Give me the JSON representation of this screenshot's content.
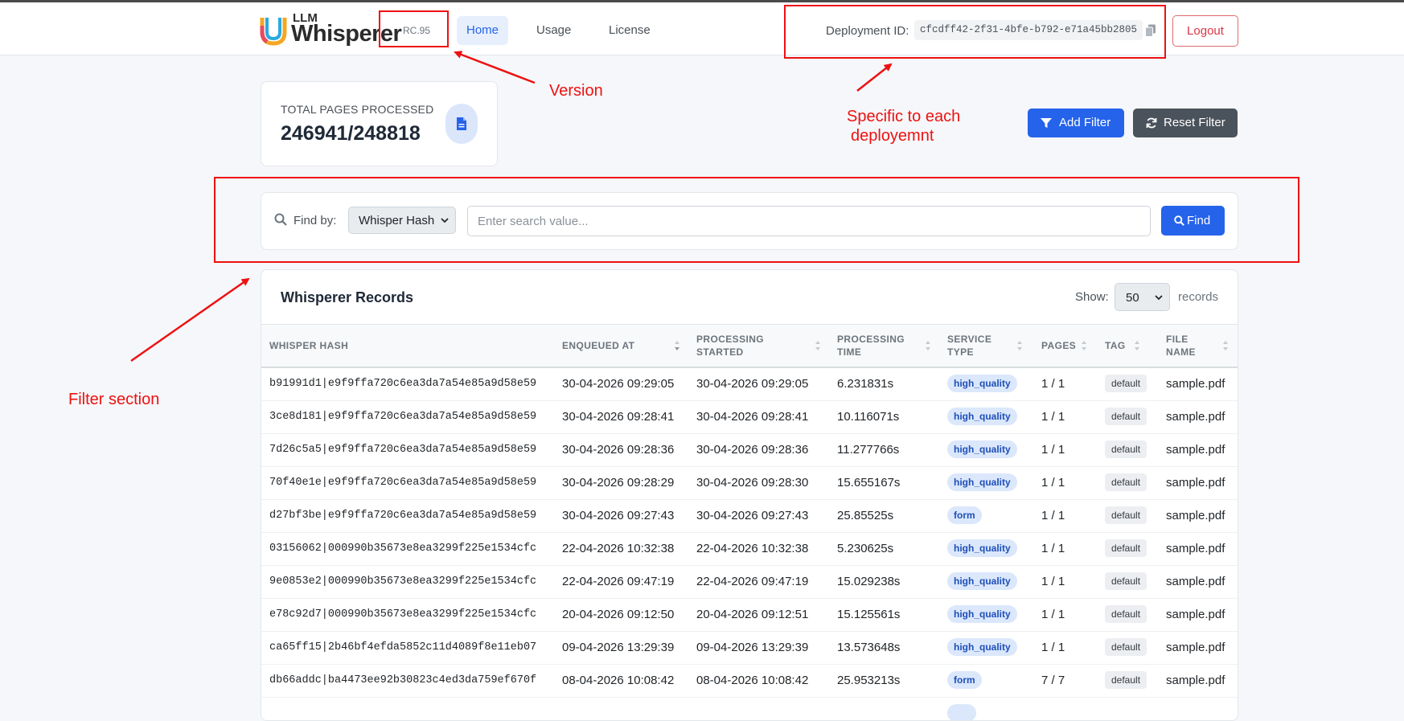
{
  "app": {
    "logo_top": "LLM",
    "logo_name": "Whisperer",
    "version": "RC.95"
  },
  "nav": {
    "home": "Home",
    "usage": "Usage",
    "license": "License"
  },
  "deployment": {
    "label": "Deployment ID:",
    "id": "cfcdff42-2f31-4bfe-b792-e71a45bb2805"
  },
  "logout_label": "Logout",
  "stats": {
    "label": "TOTAL PAGES PROCESSED",
    "value": "246941/248818",
    "icon": "document-icon"
  },
  "actions": {
    "add_filter": "Add Filter",
    "reset_filter": "Reset Filter"
  },
  "filter": {
    "find_by": "Find by:",
    "selected": "Whisper Hash",
    "placeholder": "Enter search value...",
    "find": "Find"
  },
  "records": {
    "title": "Whisperer Records",
    "show": "Show:",
    "page_size": "50",
    "records_label": "records",
    "headers": {
      "hash": "WHISPER HASH",
      "enqueued": "ENQUEUED AT",
      "started_1": "PROCESSING",
      "started_2": "STARTED",
      "time_1": "PROCESSING",
      "time_2": "TIME",
      "service_1": "SERVICE",
      "service_2": "TYPE",
      "pages": "PAGES",
      "tag": "TAG",
      "file_1": "FILE",
      "file_2": "NAME"
    },
    "rows": [
      {
        "hash": "b91991d1|e9f9ffa720c6ea3da7a54e85a9d58e59",
        "enqueued": "30-04-2026 09:29:05",
        "started": "30-04-2026 09:29:05",
        "time": "6.231831s",
        "service": "high_quality",
        "pages": "1 / 1",
        "tag": "default",
        "file": "sample.pdf"
      },
      {
        "hash": "3ce8d181|e9f9ffa720c6ea3da7a54e85a9d58e59",
        "enqueued": "30-04-2026 09:28:41",
        "started": "30-04-2026 09:28:41",
        "time": "10.116071s",
        "service": "high_quality",
        "pages": "1 / 1",
        "tag": "default",
        "file": "sample.pdf"
      },
      {
        "hash": "7d26c5a5|e9f9ffa720c6ea3da7a54e85a9d58e59",
        "enqueued": "30-04-2026 09:28:36",
        "started": "30-04-2026 09:28:36",
        "time": "11.277766s",
        "service": "high_quality",
        "pages": "1 / 1",
        "tag": "default",
        "file": "sample.pdf"
      },
      {
        "hash": "70f40e1e|e9f9ffa720c6ea3da7a54e85a9d58e59",
        "enqueued": "30-04-2026 09:28:29",
        "started": "30-04-2026 09:28:30",
        "time": "15.655167s",
        "service": "high_quality",
        "pages": "1 / 1",
        "tag": "default",
        "file": "sample.pdf"
      },
      {
        "hash": "d27bf3be|e9f9ffa720c6ea3da7a54e85a9d58e59",
        "enqueued": "30-04-2026 09:27:43",
        "started": "30-04-2026 09:27:43",
        "time": "25.85525s",
        "service": "form",
        "pages": "1 / 1",
        "tag": "default",
        "file": "sample.pdf"
      },
      {
        "hash": "03156062|000990b35673e8ea3299f225e1534cfc",
        "enqueued": "22-04-2026 10:32:38",
        "started": "22-04-2026 10:32:38",
        "time": "5.230625s",
        "service": "high_quality",
        "pages": "1 / 1",
        "tag": "default",
        "file": "sample.pdf"
      },
      {
        "hash": "9e0853e2|000990b35673e8ea3299f225e1534cfc",
        "enqueued": "22-04-2026 09:47:19",
        "started": "22-04-2026 09:47:19",
        "time": "15.029238s",
        "service": "high_quality",
        "pages": "1 / 1",
        "tag": "default",
        "file": "sample.pdf"
      },
      {
        "hash": "e78c92d7|000990b35673e8ea3299f225e1534cfc",
        "enqueued": "20-04-2026 09:12:50",
        "started": "20-04-2026 09:12:51",
        "time": "15.125561s",
        "service": "high_quality",
        "pages": "1 / 1",
        "tag": "default",
        "file": "sample.pdf"
      },
      {
        "hash": "ca65ff15|2b46bf4efda5852c11d4089f8e11eb07",
        "enqueued": "09-04-2026 13:29:39",
        "started": "09-04-2026 13:29:39",
        "time": "13.573648s",
        "service": "high_quality",
        "pages": "1 / 1",
        "tag": "default",
        "file": "sample.pdf"
      },
      {
        "hash": "db66addc|ba4473ee92b30823c4ed3da759ef670f",
        "enqueued": "08-04-2026 10:08:42",
        "started": "08-04-2026 10:08:42",
        "time": "25.953213s",
        "service": "form",
        "pages": "7 / 7",
        "tag": "default",
        "file": "sample.pdf"
      }
    ]
  },
  "annotations": {
    "version": "Version",
    "deployment_1": "Specific to each",
    "deployment_2": "deployemnt",
    "filter": "Filter section",
    "color": "#ee1111"
  }
}
